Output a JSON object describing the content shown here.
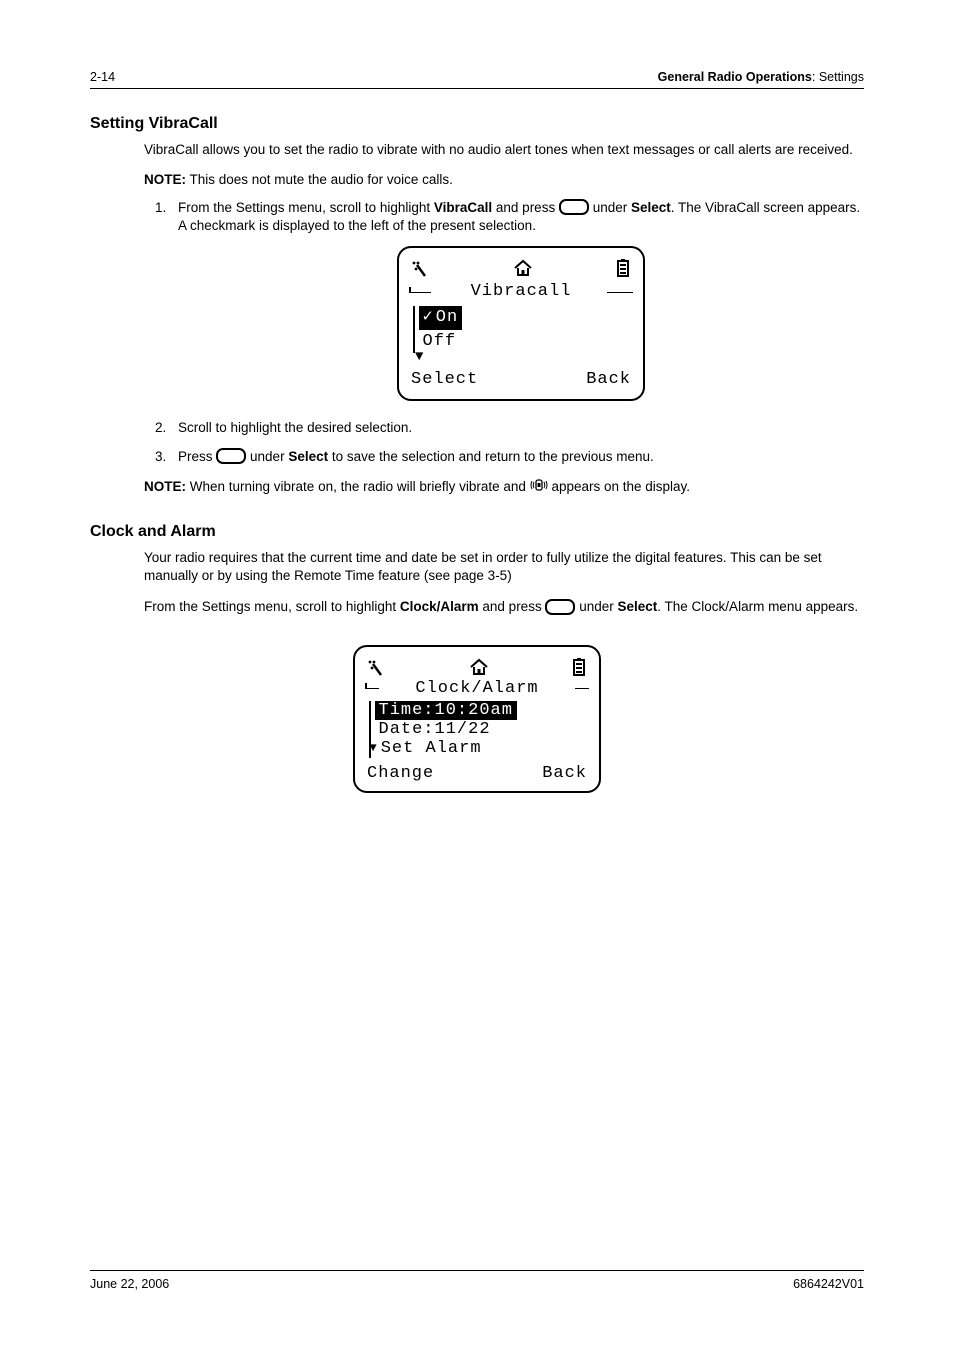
{
  "header": {
    "page_num": "2-14",
    "section_bold": "General Radio Operations",
    "section_rest": ": Settings"
  },
  "vibracall": {
    "heading": "Setting VibraCall",
    "intro": "VibraCall allows you to set the radio to vibrate with no audio alert tones when text messages or call alerts are received.",
    "note_label": "NOTE:",
    "note1_text": " This does not mute the audio for voice calls.",
    "step1_a": "From the Settings menu, scroll to highlight ",
    "step1_bold1": "VibraCall",
    "step1_b": " and press ",
    "step1_c": " under ",
    "step1_bold2": "Select",
    "step1_d": ". The VibraCall screen appears. A checkmark is displayed to the left of the present selection.",
    "screen1": {
      "title": "Vibracall",
      "row_on": "On",
      "row_off": "Off",
      "soft_left": "Select",
      "soft_right": "Back"
    },
    "step2": "Scroll to highlight the desired selection.",
    "step3_a": "Press ",
    "step3_b": " under ",
    "step3_bold": "Select",
    "step3_c": " to save the selection and return to the previous menu.",
    "note2_a": " When turning vibrate on, the radio will briefly vibrate and ",
    "note2_b": " appears on the display."
  },
  "clockalarm": {
    "heading": "Clock and Alarm",
    "para1": "Your radio requires that the current time and date be set in order to fully utilize the digital features. This can be set manually or by using the Remote Time feature (see page 3-5)",
    "para2_a": "From the Settings menu, scroll to highlight ",
    "para2_bold1": "Clock/Alarm",
    "para2_b": " and press ",
    "para2_c": " under ",
    "para2_bold2": "Select",
    "para2_d": ". The Clock/Alarm menu appears.",
    "screen2": {
      "title": "Clock/Alarm",
      "row_time": "Time:10:20am",
      "row_date": "Date:11/22",
      "row_alarm": "Set Alarm",
      "soft_left": "Change",
      "soft_right": "Back"
    }
  },
  "footer": {
    "date": "June 22, 2006",
    "docnum": "6864242V01"
  }
}
